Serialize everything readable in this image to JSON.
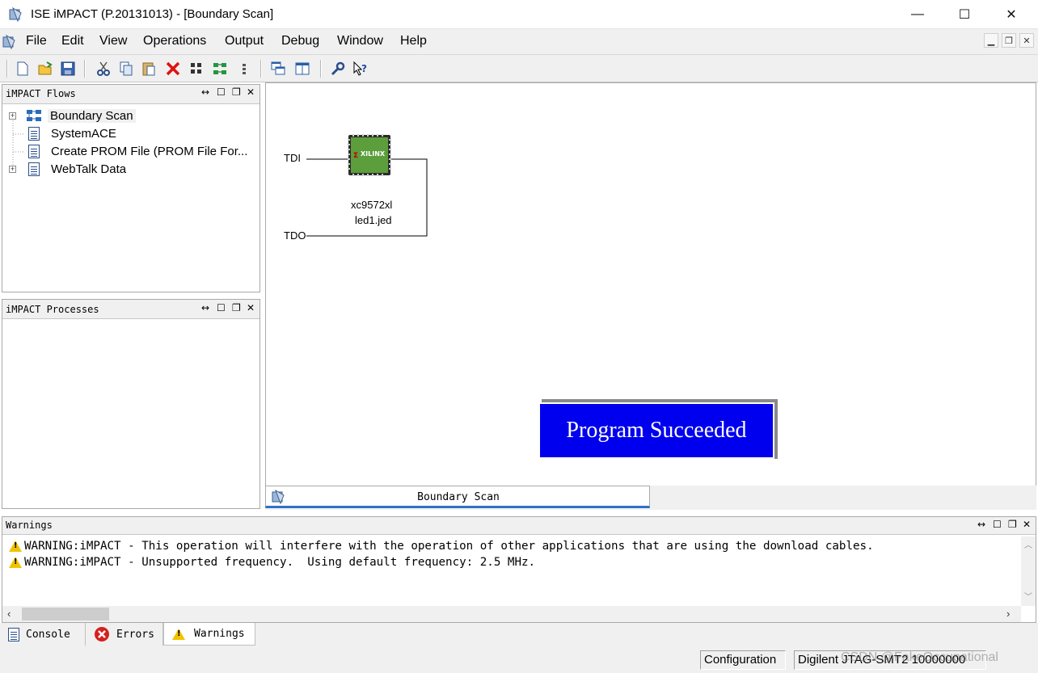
{
  "window": {
    "title": "ISE iMPACT (P.20131013) - [Boundary Scan]",
    "minimize": "—",
    "maximize": "☐",
    "close": "✕"
  },
  "menu": [
    "File",
    "Edit",
    "View",
    "Operations",
    "Output",
    "Debug",
    "Window",
    "Help"
  ],
  "flows_panel": {
    "title": "iMPACT Flows",
    "items": [
      {
        "label": "Boundary Scan",
        "expandable": true,
        "selected": true
      },
      {
        "label": "SystemACE",
        "expandable": false
      },
      {
        "label": "Create PROM File (PROM File For...",
        "expandable": false
      },
      {
        "label": "WebTalk Data",
        "expandable": true
      }
    ]
  },
  "processes_panel": {
    "title": "iMPACT Processes"
  },
  "canvas": {
    "tdi": "TDI",
    "tdo": "TDO",
    "chip_logo": "XILINX",
    "device": "xc9572xl",
    "file": "led1.jed",
    "status_message": "Program Succeeded",
    "tab_label": "Boundary Scan"
  },
  "warnings_panel": {
    "title": "Warnings",
    "lines": [
      "WARNING:iMPACT - This operation will interfere with the operation of other applications that are using the download cables.",
      "WARNING:iMPACT - Unsupported frequency.  Using default frequency: 2.5 MHz."
    ]
  },
  "bottom_tabs": [
    "Console",
    "Errors",
    "Warnings"
  ],
  "status_bar": {
    "mode": "Configuration",
    "cable": "Digilent JTAG-SMT2 10000000",
    "watermark": "CSDN @FakeOccupational"
  },
  "colors": {
    "success_bg": "#0000ee",
    "tab_accent": "#2f71c4",
    "chip_green": "#5c9e3c"
  }
}
